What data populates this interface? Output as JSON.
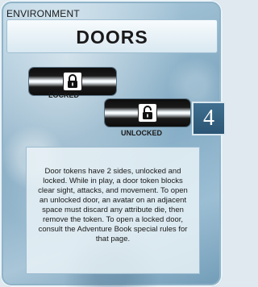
{
  "card": {
    "category": "ENVIRONMENT",
    "title": "DOORS",
    "tokens": [
      {
        "label": "LOCKED",
        "icon": "locked-padlock-icon"
      },
      {
        "label": "UNLOCKED",
        "icon": "unlocked-padlock-icon"
      }
    ],
    "count": "4",
    "rules_text": "Door tokens have 2 sides, unlocked and locked. While in play, a door token blocks clear sight, attacks, and movement. To open an unlocked door, an avatar on an adjacent space must discard any attribute die, then remove the token. To open a locked door, consult the Adventure Book special rules for that page.",
    "colors": {
      "frame": "#8fb3c8",
      "badge": "#2c5574",
      "token_dark": "#0d0d0d"
    }
  }
}
